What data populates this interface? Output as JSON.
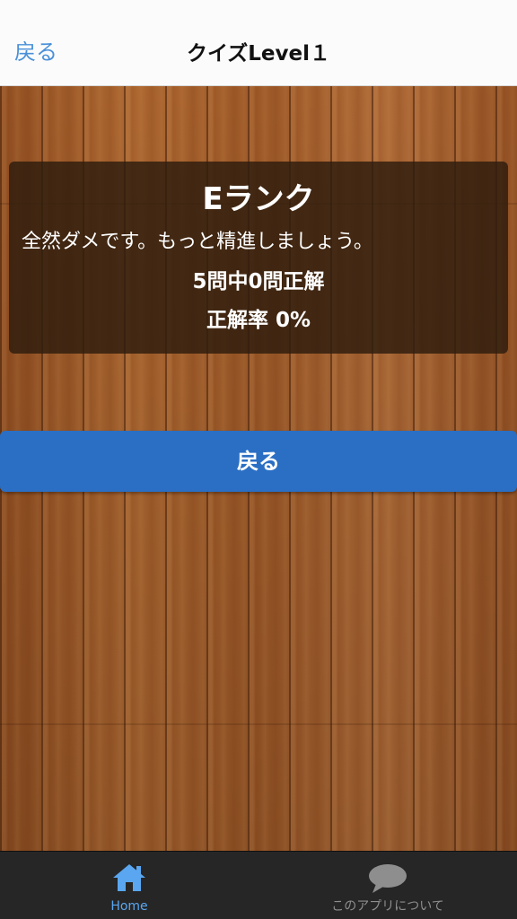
{
  "navbar": {
    "back_label": "戻る",
    "title": "クイズLevel１"
  },
  "result": {
    "rank": "Eランク",
    "message": "全然ダメです。もっと精進しましょう。",
    "score": "5問中0問正解",
    "rate": "正解率 0%"
  },
  "back_button": {
    "label": "戻る"
  },
  "tabbar": {
    "tabs": [
      {
        "label": "Home",
        "icon": "home-icon",
        "active": true
      },
      {
        "label": "このアプリについて",
        "icon": "chat-bubble-icon",
        "active": false
      }
    ]
  },
  "colors": {
    "accent": "#4a90d9",
    "button": "#2a6fc4",
    "tabbar_bg": "#262626",
    "tab_active": "#5aa6f0",
    "tab_inactive": "#8e8e8e"
  }
}
